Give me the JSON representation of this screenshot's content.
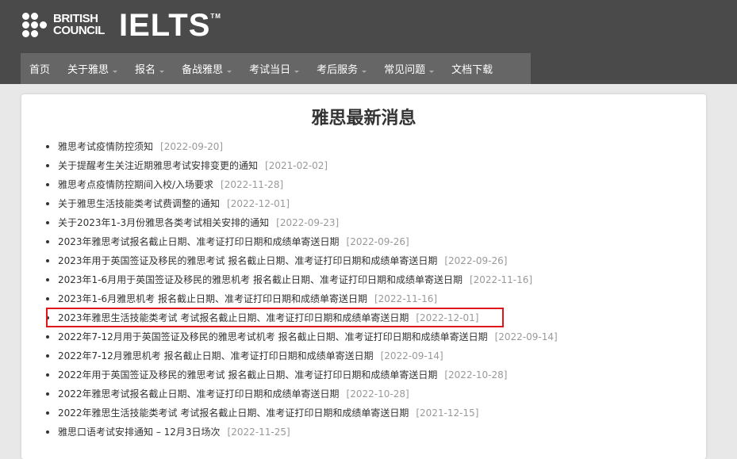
{
  "brand": {
    "org_line1": "BRITISH",
    "org_line2": "COUNCIL",
    "product": "IELTS",
    "trademark": "TM"
  },
  "nav": {
    "items": [
      {
        "label": "首页",
        "has_dropdown": false
      },
      {
        "label": "关于雅思",
        "has_dropdown": true
      },
      {
        "label": "报名",
        "has_dropdown": true
      },
      {
        "label": "备战雅思",
        "has_dropdown": true
      },
      {
        "label": "考试当日",
        "has_dropdown": true
      },
      {
        "label": "考后服务",
        "has_dropdown": true
      },
      {
        "label": "常见问题",
        "has_dropdown": true
      },
      {
        "label": "文档下载",
        "has_dropdown": false
      }
    ]
  },
  "main": {
    "title": "雅思最新消息",
    "news": [
      {
        "text": "雅思考试疫情防控须知",
        "date": "[2022-09-20]"
      },
      {
        "text": "关于提醒考生关注近期雅思考试安排变更的通知",
        "date": "[2021-02-02]"
      },
      {
        "text": "雅思考点疫情防控期间入校/入场要求",
        "date": "[2022-11-28]"
      },
      {
        "text": "关于雅思生活技能类考试费调整的通知",
        "date": "[2022-12-01]"
      },
      {
        "text": "关于2023年1-3月份雅思各类考试相关安排的通知",
        "date": "[2022-09-23]"
      },
      {
        "text": "2023年雅思考试报名截止日期、准考证打印日期和成绩单寄送日期",
        "date": "[2022-09-26]"
      },
      {
        "text": "2023年用于英国签证及移民的雅思考试 报名截止日期、准考证打印日期和成绩单寄送日期",
        "date": "[2022-09-26]"
      },
      {
        "text": "2023年1-6月用于英国签证及移民的雅思机考 报名截止日期、准考证打印日期和成绩单寄送日期",
        "date": "[2022-11-16]"
      },
      {
        "text": "2023年1-6月雅思机考 报名截止日期、准考证打印日期和成绩单寄送日期",
        "date": "[2022-11-16]"
      },
      {
        "text": "2023年雅思生活技能类考试 考试报名截止日期、准考证打印日期和成绩单寄送日期",
        "date": "[2022-12-01]"
      },
      {
        "text": "2022年7-12月用于英国签证及移民的雅思考试机考 报名截止日期、准考证打印日期和成绩单寄送日期",
        "date": "[2022-09-14]"
      },
      {
        "text": "2022年7-12月雅思机考 报名截止日期、准考证打印日期和成绩单寄送日期",
        "date": "[2022-09-14]"
      },
      {
        "text": "2022年用于英国签证及移民的雅思考试 报名截止日期、准考证打印日期和成绩单寄送日期",
        "date": "[2022-10-28]"
      },
      {
        "text": "2022年雅思考试报名截止日期、准考证打印日期和成绩单寄送日期",
        "date": "[2022-10-28]"
      },
      {
        "text": "2022年雅思生活技能类考试 考试报名截止日期、准考证打印日期和成绩单寄送日期",
        "date": "[2021-12-15]"
      },
      {
        "text": "雅思口语考试安排通知 – 12月3日场次",
        "date": "[2022-11-25]"
      }
    ]
  },
  "colors": {
    "header_bg": "#4a4a4a",
    "nav_bg": "#666666",
    "highlight_border": "#e0161b"
  }
}
